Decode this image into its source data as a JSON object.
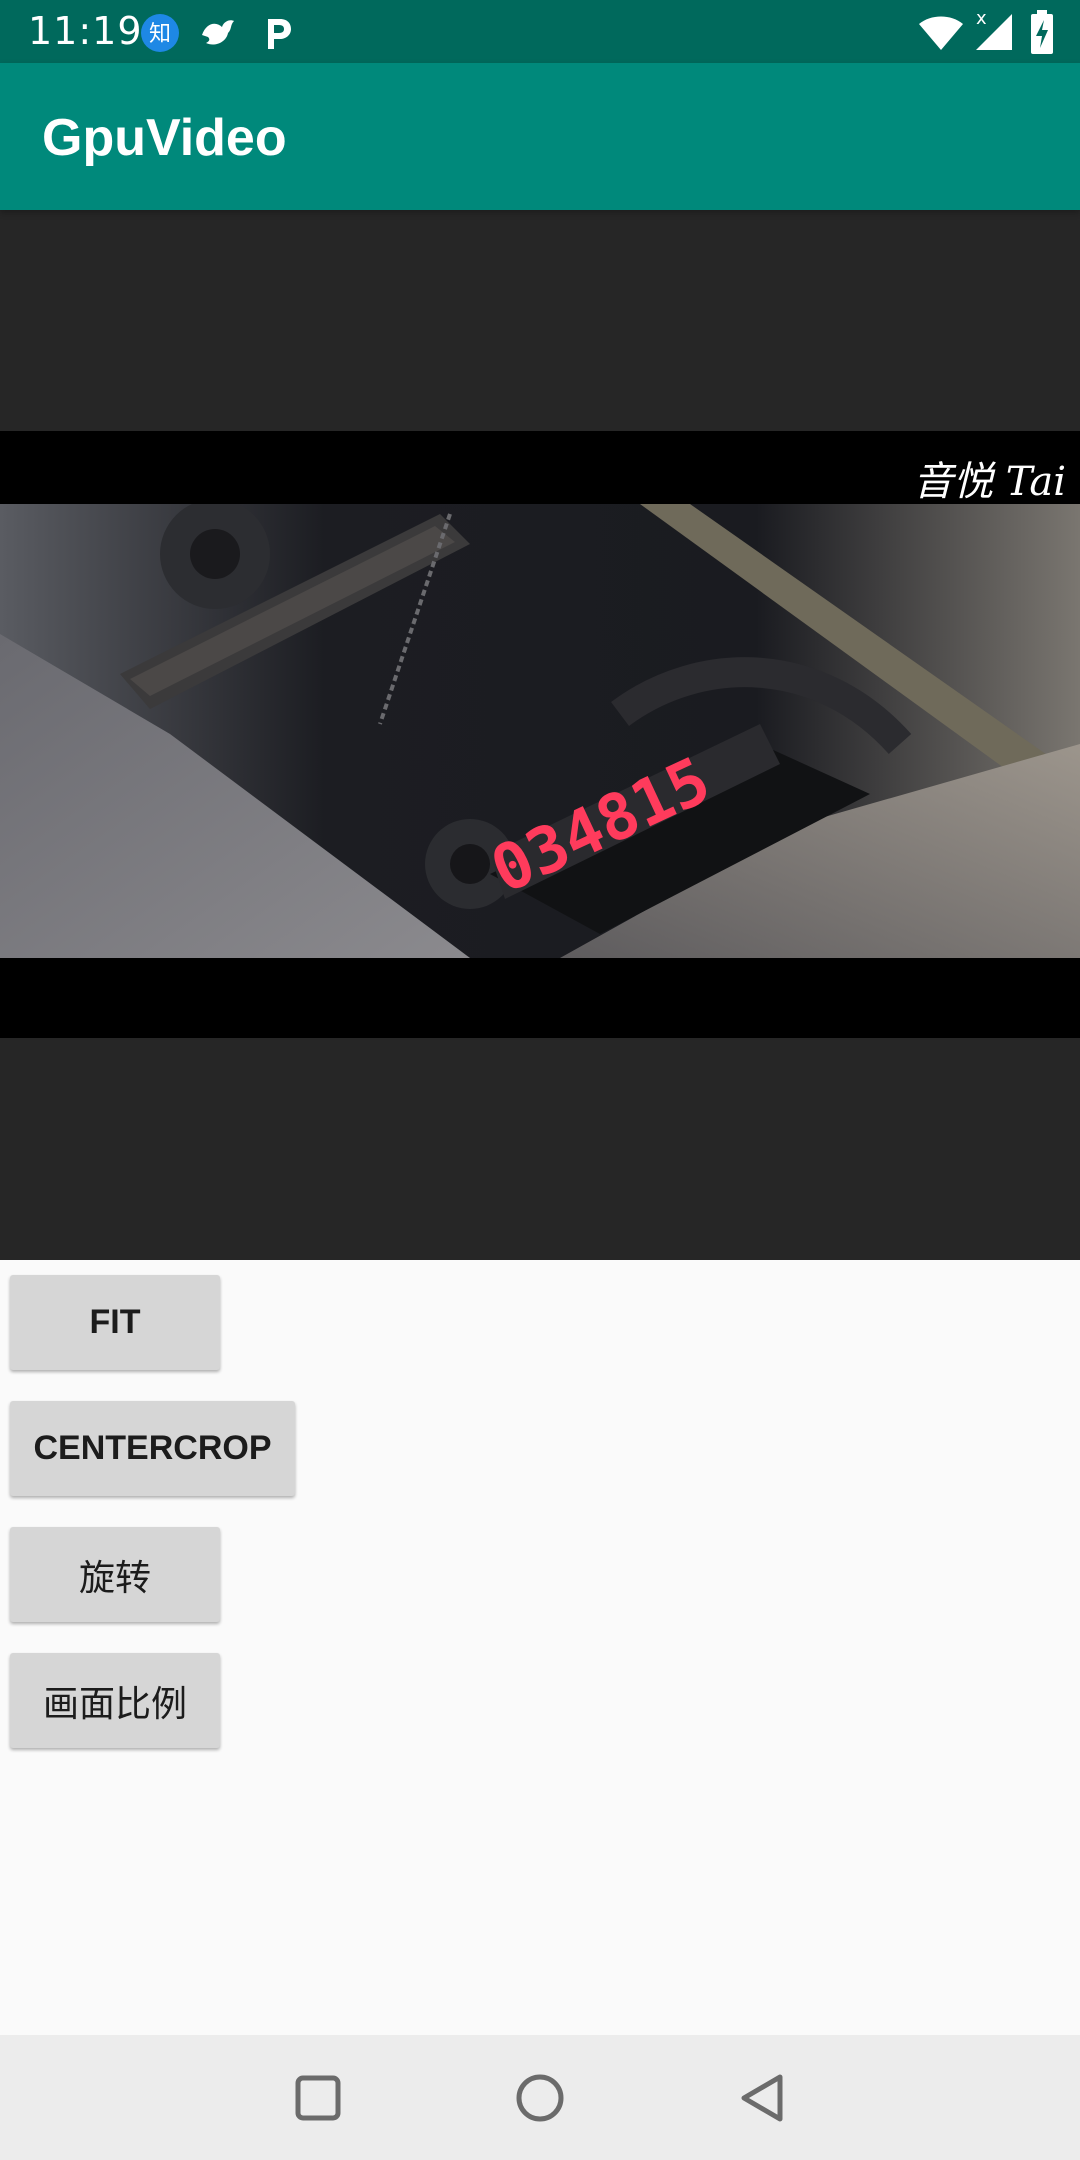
{
  "status_bar": {
    "time": "11:19",
    "left_icons": [
      "zhihu-icon",
      "bird-icon",
      "parking-p-icon"
    ],
    "zhihu_glyph": "知",
    "signal_x": "x",
    "right_icons": [
      "wifi-icon",
      "cell-signal-icon",
      "battery-charging-icon"
    ]
  },
  "app_bar": {
    "title": "GpuVideo",
    "color": "#00897b",
    "status_color": "#00695c"
  },
  "video": {
    "watermark": "音悦 Tai",
    "display_digits": "034815"
  },
  "buttons": {
    "fit": "FIT",
    "centercrop": "CENTERCROP",
    "rotate": "旋转",
    "aspect_ratio": "画面比例"
  },
  "nav_bar": {
    "icons": [
      "recents-square-icon",
      "home-circle-icon",
      "back-triangle-icon"
    ]
  }
}
